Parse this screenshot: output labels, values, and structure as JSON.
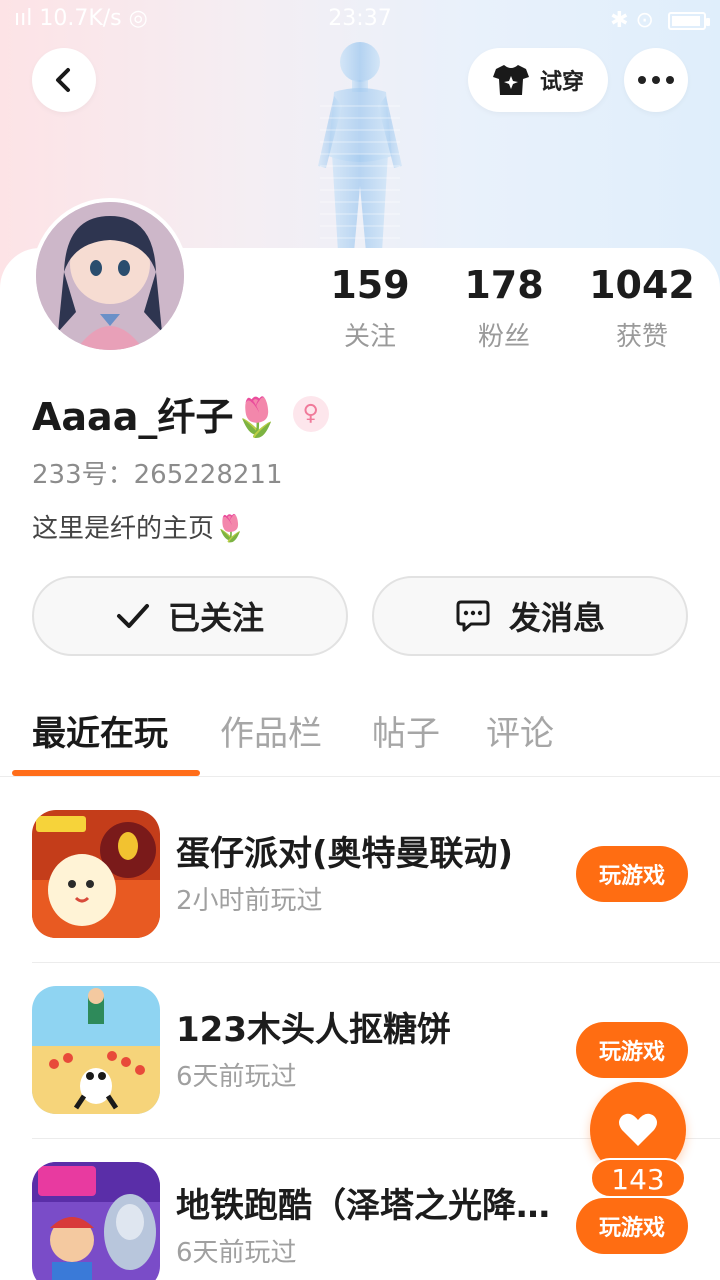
{
  "status_bar": {
    "left": "ııl 10.7K/s ◎",
    "time": "23:37",
    "right": "✱ ⊙"
  },
  "header": {
    "back_icon": "chevron-left-icon",
    "tryon_label": "试穿",
    "tryon_icon": "shirt-sparkle-icon",
    "more_icon": "more-horizontal-icon"
  },
  "profile": {
    "name": "Aaaa_纤子🌷",
    "gender_symbol": "♀",
    "uid": "233号：265228211",
    "bio": "这里是纤的主页🌷",
    "stats": [
      {
        "num": "159",
        "label": "关注"
      },
      {
        "num": "178",
        "label": "粉丝"
      },
      {
        "num": "1042",
        "label": "获赞"
      }
    ]
  },
  "actions": {
    "follow_label": "已关注",
    "message_label": "发消息"
  },
  "tabs": [
    "最近在玩",
    "作品栏",
    "帖子",
    "评论"
  ],
  "active_tab": 0,
  "games": [
    {
      "title": "蛋仔派对(奥特曼联动)",
      "sub": "2小时前玩过",
      "button": "玩游戏"
    },
    {
      "title": "123木头人抠糖饼",
      "sub": "6天前玩过",
      "button": "玩游戏"
    },
    {
      "title": "地铁跑酷（泽塔之光降临）",
      "sub": "6天前玩过",
      "button": "玩游戏"
    }
  ],
  "float": {
    "like_icon": "heart-icon",
    "count": "143"
  },
  "colors": {
    "accent": "#ff6d12",
    "text_primary": "#1c1c1c",
    "text_secondary": "#a0a0a0"
  }
}
